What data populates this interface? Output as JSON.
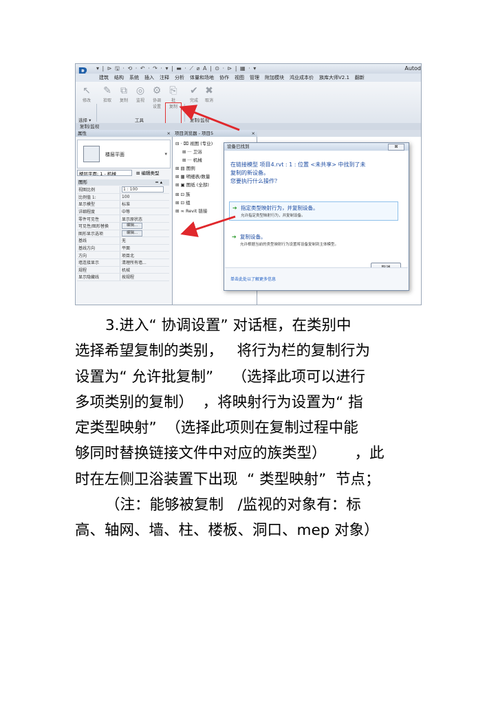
{
  "screenshot": {
    "qat_icons": "▾ | ⊳ 🖫 · ⟲ · ↶ · ↷ · ▾ | ▬ · ⟋ ⌀ A | ⊙ · ⊳ | ▦ · ▾",
    "app_title": "Autod",
    "ribbon_tabs": [
      "建筑",
      "结构",
      "系统",
      "插入",
      "注释",
      "分析",
      "体量和场地",
      "协作",
      "视图",
      "管理",
      "附加模块",
      "鸿业成本价",
      "族库大师V2.1",
      "翻新"
    ],
    "ribbon_buttons": [
      {
        "label": "修改",
        "icon": "↖"
      },
      {
        "label": "拾取",
        "icon": "✎"
      },
      {
        "label": "复制",
        "icon": "⧉"
      },
      {
        "label": "监视",
        "icon": "◎"
      },
      {
        "label": "协调\n设置",
        "icon": "⚙"
      },
      {
        "label": "批\n复制",
        "icon": "⎘"
      },
      {
        "label": "完成",
        "icon": "✔"
      },
      {
        "label": "取消",
        "icon": "✖"
      }
    ],
    "group_labels": [
      "选择 ▾",
      "工具",
      "复制/监视"
    ],
    "select_bar": "复制/监视",
    "properties": {
      "header": "属性",
      "type_name": "楼层平面",
      "filter": "楼层平面: 1 - 机械",
      "edit_type": "编辑类型",
      "group": "图形",
      "rows": [
        {
          "k": "视图比例",
          "v": "1 : 100",
          "kind": "input"
        },
        {
          "k": "比例值 1:",
          "v": "100",
          "kind": "text"
        },
        {
          "k": "显示模型",
          "v": "标准",
          "kind": "text"
        },
        {
          "k": "详细程度",
          "v": "中等",
          "kind": "text"
        },
        {
          "k": "零件可见性",
          "v": "显示原状态",
          "kind": "text"
        },
        {
          "k": "可见性/图形替换",
          "v": "编辑...",
          "kind": "button"
        },
        {
          "k": "图形显示选项",
          "v": "编辑...",
          "kind": "button"
        },
        {
          "k": "基线",
          "v": "无",
          "kind": "text"
        },
        {
          "k": "基线方向",
          "v": "平面",
          "kind": "text"
        },
        {
          "k": "方向",
          "v": "项目北",
          "kind": "text"
        },
        {
          "k": "墙连接显示",
          "v": "清理所有墙...",
          "kind": "text"
        },
        {
          "k": "规程",
          "v": "机械",
          "kind": "text"
        },
        {
          "k": "显示隐藏线",
          "v": "按规程",
          "kind": "text"
        }
      ]
    },
    "browser": {
      "header": "项目浏览器 - 项目5",
      "nodes": [
        {
          "text": "⊟ · ⌧ 视图 (专业)",
          "indent": 0
        },
        {
          "text": "⊞ ··· 卫浴",
          "indent": 1
        },
        {
          "text": "⊞ ··· 机械",
          "indent": 1
        },
        {
          "text": "⊞ ▤ 图例",
          "indent": 0
        },
        {
          "text": "⊞ ▦ 明细表/数量",
          "indent": 0
        },
        {
          "text": "⊞ ▣ 图纸 (全部)",
          "indent": 0
        },
        {
          "text": "⊞ ⊡ 族",
          "indent": 0
        },
        {
          "text": "⊞ ⊡ 组",
          "indent": 0
        },
        {
          "text": "⊞ ∞ Revit 链接",
          "indent": 0
        }
      ]
    },
    "dialog": {
      "title": "设备已找到",
      "close": "⊠",
      "message_lines": [
        "在链接模型 项目4.rvt : 1 : 位置 <未共享> 中找到了未",
        "复制的新设备。",
        "您要执行什么操作？"
      ],
      "options": [
        {
          "title": "指定类型映射行为，并复制设备。",
          "desc": "允许指定类型映射行为，并复制设备。",
          "highlighted": true
        },
        {
          "title": "复制设备。",
          "desc": "允许根据当前的类型映射行为设置将设备复制到主体模型。",
          "highlighted": false
        }
      ],
      "cancel": "取消",
      "footer_link": "单击此处以了解更多信息"
    },
    "arrow_color": "#e0282c"
  },
  "body": {
    "lines": [
      {
        "text": "3.进入“ 协调设置” 对话框，在类别中",
        "indent": true
      },
      {
        "text": "选择希望复制的类别，   将行为栏的复制行为",
        "indent": false
      },
      {
        "text": "设置为“ 允许批复制”    （选择此项可以进行",
        "indent": false
      },
      {
        "text": "多项类别的复制）  ，将映射行为设置为“ 指",
        "indent": false
      },
      {
        "text": "定类型映射”  （选择此项则在复制过程中能",
        "indent": false
      },
      {
        "text": "够同时替换链接文件中对应的族类型）      ，此",
        "indent": false
      },
      {
        "text": "时在左侧卫浴装置下出现  “ 类型映射”  节点；",
        "indent": false
      },
      {
        "text": "（注：能够被复制   /监视的对象有：标",
        "indent": true
      },
      {
        "text": "高、轴网、墙、柱、楼板、洞口、mep 对象）",
        "indent": false
      }
    ]
  }
}
